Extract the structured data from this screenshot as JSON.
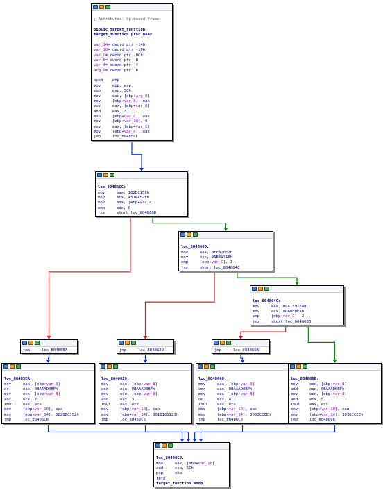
{
  "theme": {
    "edge_true": "#0a8a0a",
    "edge_false": "#d42020",
    "edge_uncond": "#1030d0",
    "text": "#000080",
    "label": "#000080",
    "comment": "#5a5a5a",
    "var": "#9b00d6",
    "number": "#006400"
  },
  "blocks": [
    {
      "id": "entry",
      "icons": [
        "graph-icon",
        "edit-icon",
        "xref-icon"
      ],
      "lines": [
        [],
        [
          {
            "t": "; Attributes: bp-based frame",
            "c": "comment"
          }
        ],
        [],
        [
          {
            "t": "public target_function",
            "c": "label"
          }
        ],
        [
          {
            "t": "target_function proc near",
            "c": "label"
          }
        ],
        [],
        [
          {
            "t": "var_14",
            "c": "var"
          },
          {
            "t": "= dword ptr -14h"
          }
        ],
        [
          {
            "t": "var_10",
            "c": "var"
          },
          {
            "t": "= dword ptr -10h"
          }
        ],
        [
          {
            "t": "var_C",
            "c": "var"
          },
          {
            "t": "= dword ptr -0Ch"
          }
        ],
        [
          {
            "t": "var_8",
            "c": "var"
          },
          {
            "t": "= dword ptr -8"
          }
        ],
        [
          {
            "t": "var_4",
            "c": "var"
          },
          {
            "t": "= dword ptr -4"
          }
        ],
        [
          {
            "t": "arg_0",
            "c": "var"
          },
          {
            "t": "= dword ptr  8"
          }
        ],
        [],
        [
          {
            "t": "push    ebp"
          }
        ],
        [
          {
            "t": "mov     ebp, esp"
          }
        ],
        [
          {
            "t": "sub     esp, 5Ch"
          }
        ],
        [
          {
            "t": "mov     eax, [ebp+"
          },
          {
            "t": "arg_0",
            "c": "var"
          },
          {
            "t": "]"
          }
        ],
        [
          {
            "t": "mov     [ebp+"
          },
          {
            "t": "var_8",
            "c": "var"
          },
          {
            "t": "], eax"
          }
        ],
        [
          {
            "t": "mov     eax, [ebp+"
          },
          {
            "t": "var_8",
            "c": "var"
          },
          {
            "t": "]"
          }
        ],
        [
          {
            "t": "and     eax, 3"
          }
        ],
        [
          {
            "t": "mov     [ebp+"
          },
          {
            "t": "var_C",
            "c": "var"
          },
          {
            "t": "], eax"
          }
        ],
        [
          {
            "t": "mov     [ebp+"
          },
          {
            "t": "var_10",
            "c": "var"
          },
          {
            "t": "], 0"
          }
        ],
        [
          {
            "t": "mov     eax, [ebp+"
          },
          {
            "t": "var_C",
            "c": "var"
          },
          {
            "t": "]"
          }
        ],
        [
          {
            "t": "mov     [ebp+"
          },
          {
            "t": "var_4",
            "c": "var"
          },
          {
            "t": "], eax"
          }
        ],
        [
          {
            "t": "jmp     loc_80485CC"
          }
        ]
      ]
    },
    {
      "id": "loc_80485CC",
      "icons": [
        "graph-icon",
        "edit-icon",
        "xref-icon"
      ],
      "lines": [
        [],
        [
          {
            "t": "loc_80485CC:",
            "c": "label"
          }
        ],
        [
          {
            "t": "mov     eax, 102DC15Ch"
          }
        ],
        [
          {
            "t": "mov     ecx, 4576452Eh"
          }
        ],
        [
          {
            "t": "mov     edx, [ebp+"
          },
          {
            "t": "var_4",
            "c": "var"
          },
          {
            "t": "]"
          }
        ],
        [
          {
            "t": "cmp     edx, 0"
          }
        ],
        [
          {
            "t": "jnz     short loc_804860D"
          }
        ]
      ]
    },
    {
      "id": "loc_804860D",
      "icons": [
        "graph-icon",
        "edit-icon",
        "xref-icon"
      ],
      "lines": [
        [],
        [
          {
            "t": "loc_804860D:",
            "c": "label"
          }
        ],
        [
          {
            "t": "mov     eax, 0FFA10E2h"
          }
        ],
        [
          {
            "t": "mov     ecx, 95EE1718h"
          }
        ],
        [
          {
            "t": "cmp     [ebp+"
          },
          {
            "t": "var_C",
            "c": "var"
          },
          {
            "t": "], 1"
          }
        ],
        [
          {
            "t": "jnz     short loc_804864C"
          }
        ]
      ]
    },
    {
      "id": "loc_804864C",
      "icons": [
        "graph-icon",
        "edit-icon",
        "xref-icon"
      ],
      "lines": [
        [],
        [
          {
            "t": "loc_804864C:",
            "c": "label"
          }
        ],
        [
          {
            "t": "mov     eax, 0C41F91E4h"
          }
        ],
        [
          {
            "t": "mov     ecx, 0DA0EDEAh"
          }
        ],
        [
          {
            "t": "cmp     [ebp+"
          },
          {
            "t": "var_C",
            "c": "var"
          },
          {
            "t": "], 2"
          }
        ],
        [
          {
            "t": "jnz     short loc_804868B"
          }
        ]
      ]
    },
    {
      "id": "jmp_80485EA",
      "icons": [
        "graph-icon",
        "edit-icon",
        "xref-icon"
      ],
      "lines": [
        [
          {
            "t": "jmp     loc_80485EA"
          }
        ]
      ]
    },
    {
      "id": "jmp_8048629",
      "icons": [
        "graph-icon",
        "edit-icon",
        "xref-icon"
      ],
      "lines": [
        [
          {
            "t": "jmp     loc_8048629"
          }
        ]
      ]
    },
    {
      "id": "jmp_8048668",
      "icons": [
        "graph-icon",
        "edit-icon",
        "xref-icon"
      ],
      "lines": [
        [
          {
            "t": "jmp     loc_8048668"
          }
        ]
      ]
    },
    {
      "id": "loc_80485EA",
      "icons": [
        "graph-icon",
        "edit-icon",
        "xref-icon"
      ],
      "lines": [
        [],
        [
          {
            "t": "loc_80485EA:",
            "c": "label"
          }
        ],
        [
          {
            "t": "mov     eax, [ebp+"
          },
          {
            "t": "var_8",
            "c": "var"
          },
          {
            "t": "]"
          }
        ],
        [
          {
            "t": "or      eax, 0BAAAD0BFh"
          }
        ],
        [
          {
            "t": "mov     ecx, [ebp+"
          },
          {
            "t": "var_8",
            "c": "var"
          },
          {
            "t": "]"
          }
        ],
        [
          {
            "t": "xor     ecx, 2"
          }
        ],
        [
          {
            "t": "imul    eax, ecx"
          }
        ],
        [
          {
            "t": "mov     [ebp+"
          },
          {
            "t": "var_10",
            "c": "var"
          },
          {
            "t": "], eax"
          }
        ],
        [
          {
            "t": "mov     [ebp+"
          },
          {
            "t": "var_14",
            "c": "var"
          },
          {
            "t": "], 0028BC352h"
          }
        ],
        [
          {
            "t": "jmp     loc_80486C6"
          }
        ]
      ]
    },
    {
      "id": "loc_8048629",
      "icons": [
        "graph-icon",
        "edit-icon",
        "xref-icon"
      ],
      "lines": [
        [],
        [
          {
            "t": "loc_8048629:",
            "c": "label"
          }
        ],
        [
          {
            "t": "mov     eax, [ebp+"
          },
          {
            "t": "var_8",
            "c": "var"
          },
          {
            "t": "]"
          }
        ],
        [
          {
            "t": "and     eax, 0BAAAD0BFh"
          }
        ],
        [
          {
            "t": "mov     ecx, [ebp+"
          },
          {
            "t": "var_8",
            "c": "var"
          },
          {
            "t": "]"
          }
        ],
        [
          {
            "t": "add     ecx, 3"
          }
        ],
        [
          {
            "t": "imul    eax, ecx"
          }
        ],
        [
          {
            "t": "mov     [ebp+"
          },
          {
            "t": "var_10",
            "c": "var"
          },
          {
            "t": "], eax"
          }
        ],
        [
          {
            "t": "mov     [ebp+"
          },
          {
            "t": "var_14",
            "c": "var"
          },
          {
            "t": "], 0010161123h"
          }
        ],
        [
          {
            "t": "jmp     loc_80486C6"
          }
        ]
      ]
    },
    {
      "id": "loc_8048668",
      "icons": [
        "graph-icon",
        "edit-icon",
        "xref-icon"
      ],
      "lines": [
        [],
        [
          {
            "t": "loc_8048668:",
            "c": "label"
          }
        ],
        [
          {
            "t": "mov     eax, [ebp+"
          },
          {
            "t": "var_8",
            "c": "var"
          },
          {
            "t": "]"
          }
        ],
        [
          {
            "t": "xor     eax, 0BAAAD0BFh"
          }
        ],
        [
          {
            "t": "mov     ecx, [ebp+"
          },
          {
            "t": "var_8",
            "c": "var"
          },
          {
            "t": "]"
          }
        ],
        [
          {
            "t": "or      ecx, 4"
          }
        ],
        [
          {
            "t": "imul    eax, ecx"
          }
        ],
        [
          {
            "t": "mov     [ebp+"
          },
          {
            "t": "var_10",
            "c": "var"
          },
          {
            "t": "], eax"
          }
        ],
        [
          {
            "t": "mov     [ebp+"
          },
          {
            "t": "var_14",
            "c": "var"
          },
          {
            "t": "], 303DCCEEh"
          }
        ],
        [
          {
            "t": "jmp     loc_80486C6"
          }
        ]
      ]
    },
    {
      "id": "loc_804868B",
      "icons": [
        "graph-icon",
        "edit-icon",
        "xref-icon"
      ],
      "lines": [
        [],
        [
          {
            "t": "loc_804868B:",
            "c": "label"
          }
        ],
        [
          {
            "t": "mov     eax, [ebp+"
          },
          {
            "t": "var_8",
            "c": "var"
          },
          {
            "t": "]"
          }
        ],
        [
          {
            "t": "add     eax, 0BAAAD0BFh"
          }
        ],
        [
          {
            "t": "mov     ecx, [ebp+"
          },
          {
            "t": "var_8",
            "c": "var"
          },
          {
            "t": "]"
          }
        ],
        [
          {
            "t": "and     ecx, 5"
          }
        ],
        [
          {
            "t": "imul    eax, ecx"
          }
        ],
        [
          {
            "t": "mov     [ebp+"
          },
          {
            "t": "var_10",
            "c": "var"
          },
          {
            "t": "], eax"
          }
        ],
        [
          {
            "t": "mov     [ebp+"
          },
          {
            "t": "var_14",
            "c": "var"
          },
          {
            "t": "], 303DCCEEh"
          }
        ],
        [
          {
            "t": "jmp     loc_80486C6"
          }
        ]
      ]
    },
    {
      "id": "loc_80486C6",
      "icons": [
        "graph-icon",
        "edit-icon",
        "xref-icon"
      ],
      "lines": [
        [],
        [
          {
            "t": "loc_80486C6:",
            "c": "label"
          }
        ],
        [
          {
            "t": "mov     eax, [ebp+"
          },
          {
            "t": "var_10",
            "c": "var"
          },
          {
            "t": "]"
          }
        ],
        [
          {
            "t": "add     esp, 5Ch"
          }
        ],
        [
          {
            "t": "pop     ebp"
          }
        ],
        [
          {
            "t": "retn"
          }
        ],
        [
          {
            "t": "target_function endp",
            "c": "label"
          }
        ]
      ]
    }
  ],
  "edges": [
    {
      "from": "entry",
      "to": "loc_80485CC",
      "kind": "uncond"
    },
    {
      "from": "loc_80485CC",
      "to": "loc_804860D",
      "kind": "true"
    },
    {
      "from": "loc_80485CC",
      "to": "jmp_80485EA",
      "kind": "false"
    },
    {
      "from": "loc_804860D",
      "to": "loc_804864C",
      "kind": "true"
    },
    {
      "from": "loc_804860D",
      "to": "jmp_8048629",
      "kind": "false"
    },
    {
      "from": "loc_804864C",
      "to": "loc_804868B",
      "kind": "true"
    },
    {
      "from": "loc_804864C",
      "to": "jmp_8048668",
      "kind": "false"
    },
    {
      "from": "jmp_80485EA",
      "to": "loc_80485EA",
      "kind": "uncond"
    },
    {
      "from": "jmp_8048629",
      "to": "loc_8048629",
      "kind": "uncond"
    },
    {
      "from": "jmp_8048668",
      "to": "loc_8048668",
      "kind": "uncond"
    },
    {
      "from": "loc_80485EA",
      "to": "loc_80486C6",
      "kind": "uncond"
    },
    {
      "from": "loc_8048629",
      "to": "loc_80486C6",
      "kind": "uncond"
    },
    {
      "from": "loc_8048668",
      "to": "loc_80486C6",
      "kind": "uncond"
    },
    {
      "from": "loc_804868B",
      "to": "loc_80486C6",
      "kind": "uncond"
    }
  ]
}
